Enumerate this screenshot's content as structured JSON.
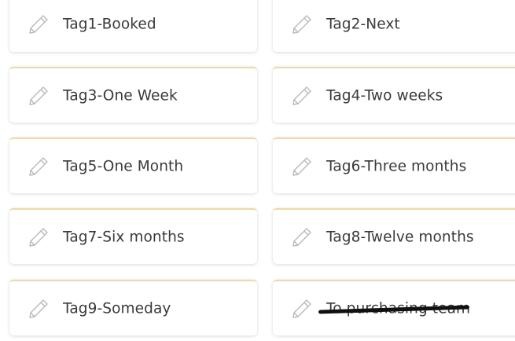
{
  "tags": [
    {
      "label": "Tag1-Booked",
      "icon": "pencil-icon"
    },
    {
      "label": "Tag2-Next",
      "icon": "pencil-icon"
    },
    {
      "label": "Tag3-One Week",
      "icon": "pencil-icon"
    },
    {
      "label": "Tag4-Two weeks",
      "icon": "pencil-icon"
    },
    {
      "label": "Tag5-One Month",
      "icon": "pencil-icon"
    },
    {
      "label": "Tag6-Three months",
      "icon": "pencil-icon"
    },
    {
      "label": "Tag7-Six months",
      "icon": "pencil-icon"
    },
    {
      "label": "Tag8-Twelve months",
      "icon": "pencil-icon"
    },
    {
      "label": "Tag9-Someday",
      "icon": "pencil-icon"
    },
    {
      "label": "To purchasing team",
      "icon": "pencil-icon",
      "struck_through": true
    }
  ],
  "colors": {
    "card_top_border": "#efd9a4",
    "text": "#3a3a3a",
    "icon": "#b9b9b9",
    "strike": "#111111"
  }
}
